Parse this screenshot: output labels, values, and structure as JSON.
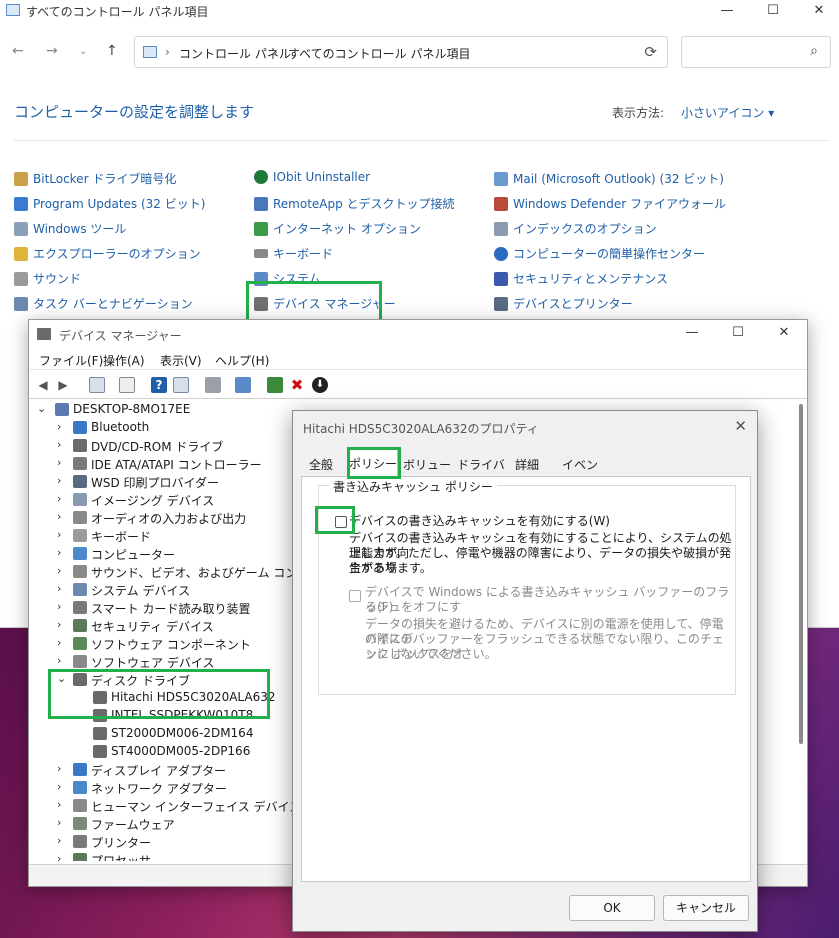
{
  "control_panel": {
    "window_title": "すべてのコントロール パネル項目",
    "breadcrumb": [
      "コントロール パネル",
      "すべてのコントロール パネル項目"
    ],
    "heading": "コンピューターの設定を調整します",
    "view_by_label": "表示方法:",
    "view_by_value": "小さいアイコン",
    "items_col1": [
      "BitLocker ドライブ暗号化",
      "Program Updates (32 ビット)",
      "Windows ツール",
      "エクスプローラーのオプション",
      "サウンド",
      "タスク バーとナビゲーション"
    ],
    "items_col2": [
      "IObit Uninstaller",
      "RemoteApp とデスクトップ接続",
      "インターネット オプション",
      "キーボード",
      "システム",
      "デバイス マネージャー"
    ],
    "items_col3": [
      "Mail (Microsoft Outlook) (32 ビット)",
      "Windows Defender ファイアウォール",
      "インデックスのオプション",
      "コンピューターの簡単操作センター",
      "セキュリティとメンテナンス",
      "デバイスとプリンター"
    ]
  },
  "device_manager": {
    "window_title": "デバイス マネージャー",
    "menu": [
      "ファイル(F)",
      "操作(A)",
      "表示(V)",
      "ヘルプ(H)"
    ],
    "root": "DESKTOP-8MO17EE",
    "categories_before": [
      "Bluetooth",
      "DVD/CD-ROM ドライブ",
      "IDE ATA/ATAPI コントローラー",
      "WSD 印刷プロバイダー",
      "イメージング デバイス",
      "オーディオの入力および出力",
      "キーボード",
      "コンピューター",
      "サウンド、ビデオ、およびゲーム コントローラー",
      "システム デバイス",
      "スマート カード読み取り装置",
      "セキュリティ デバイス",
      "ソフトウェア コンポーネント",
      "ソフトウェア デバイス"
    ],
    "expanded_category": "ディスク ドライブ",
    "disks": [
      "Hitachi HDS5C3020ALA632",
      "INTEL SSDPEKKW010T8",
      "ST2000DM006-2DM164",
      "ST4000DM005-2DP166"
    ],
    "categories_after": [
      "ディスプレイ アダプター",
      "ネットワーク アダプター",
      "ヒューマン インターフェイス デバイス",
      "ファームウェア",
      "プリンター",
      "プロセッサ"
    ]
  },
  "properties": {
    "title": "Hitachi HDS5C3020ALA632のプロパティ",
    "tabs": [
      "全般",
      "ポリシー",
      "ボリューム",
      "ドライバー",
      "詳細",
      "イベント"
    ],
    "active_tab": "ポリシー",
    "group_label": "書き込みキャッシュ ポリシー",
    "opt1_label": "デバイスの書き込みキャッシュを有効にする(W)",
    "opt1_desc": [
      "デバイスの書き込みキャッシュを有効にすることにより、システムの処理能力が向",
      "上します。ただし、停電や機器の障害により、データの損失や破損が発生する場",
      "合があります。"
    ],
    "opt2_label": [
      "デバイスで Windows による書き込みキャッシュ バッファーのフラッシュをオフにす",
      "る(F)"
    ],
    "opt2_desc": [
      "データの損失を避けるため、デバイスに別の電源を使用して、停電の際にデ",
      "バイスのバッファーをフラッシュできる状態でない限り、このチェック ボックスをオ",
      "ンにしないでください。"
    ],
    "ok": "OK",
    "cancel": "キャンセル"
  },
  "colors": {
    "highlight": "#22b04a",
    "link": "#1e5fa8"
  }
}
